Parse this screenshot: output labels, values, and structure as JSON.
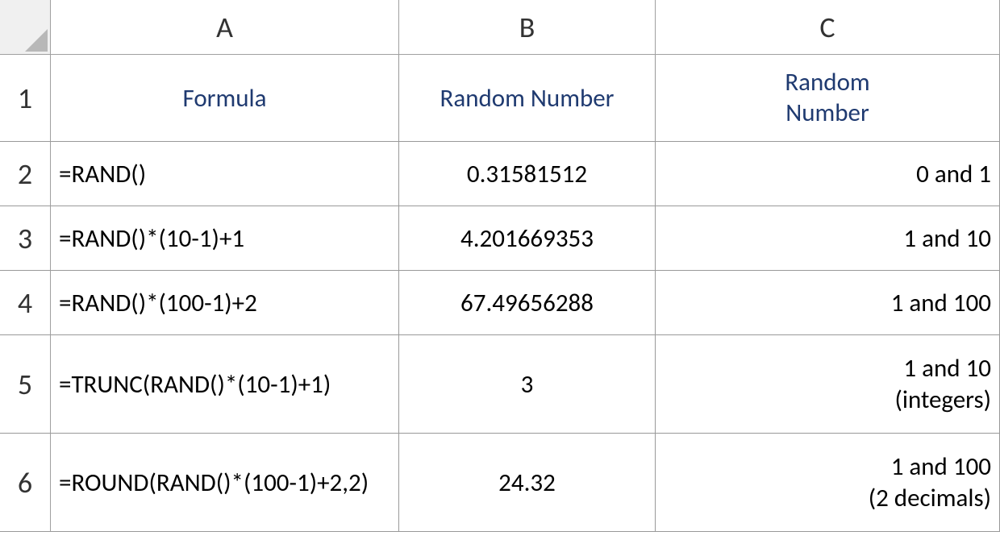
{
  "columns": {
    "A": "A",
    "B": "B",
    "C": "C"
  },
  "rowNumbers": {
    "r1": "1",
    "r2": "2",
    "r3": "3",
    "r4": "4",
    "r5": "5",
    "r6": "6"
  },
  "header": {
    "A": "Formula",
    "B": "Random Number",
    "C_line1": "Random",
    "C_line2": "Number"
  },
  "rows": {
    "r2": {
      "A": "=RAND()",
      "B": "0.31581512",
      "C": "0 and 1"
    },
    "r3": {
      "A": "=RAND()*(10-1)+1",
      "B": "4.201669353",
      "C": "1 and 10"
    },
    "r4": {
      "A": "=RAND()*(100-1)+2",
      "B": "67.49656288",
      "C": "1 and 100"
    },
    "r5": {
      "A": "=TRUNC(RAND()*(10-1)+1)",
      "B": "3",
      "C_line1": "1 and 10",
      "C_line2": "(integers)"
    },
    "r6": {
      "A": "=ROUND(RAND()*(100-1)+2,2)",
      "B": "24.32",
      "C_line1": "1 and 100",
      "C_line2": "(2 decimals)"
    }
  }
}
